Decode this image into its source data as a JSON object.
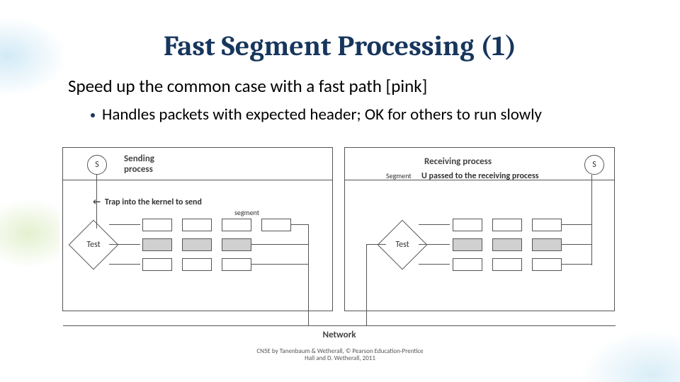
{
  "title": "Fast Segment Processing (1)",
  "intro": "Speed up the common case with a fast path [pink]",
  "bullet": "Handles packets with expected header; OK for others to run slowly",
  "diagram": {
    "send_proc": "Sending",
    "send_proc_sub": "process",
    "recv_proc": "Receiving process",
    "trap_label": "Trap into the kernel to send",
    "segment_lower": "segment",
    "segment_upper": "Segment",
    "passed_label": "U passed to the receiving process",
    "test": "Test",
    "s": "S",
    "network": "Network"
  },
  "footer": {
    "l1": "CN5E by Tanenbaum & Wetherall, © Pearson Education-Prentice",
    "l2": "Hall and D. Wetherall, 2011"
  }
}
